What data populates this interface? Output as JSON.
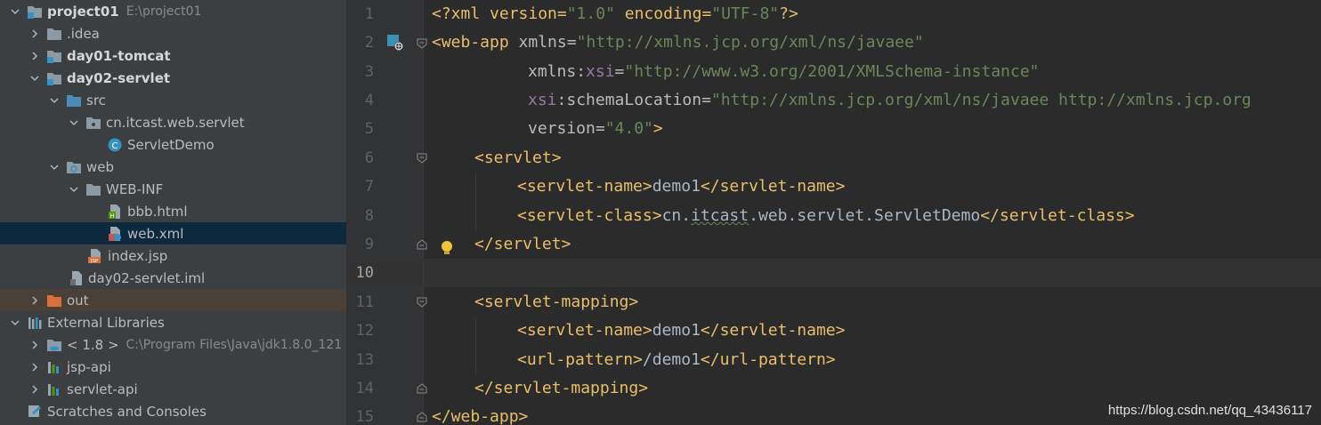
{
  "project_tree": {
    "project": {
      "name": "project01",
      "path": "E:\\project01"
    },
    "items": [
      {
        "label": ".idea"
      },
      {
        "label": "day01-tomcat"
      },
      {
        "label": "day02-servlet"
      },
      {
        "label": "src"
      },
      {
        "label": "cn.itcast.web.servlet"
      },
      {
        "label": "ServletDemo"
      },
      {
        "label": "web"
      },
      {
        "label": "WEB-INF"
      },
      {
        "label": "bbb.html"
      },
      {
        "label": "web.xml"
      },
      {
        "label": "index.jsp"
      },
      {
        "label": "day02-servlet.iml"
      },
      {
        "label": "out"
      },
      {
        "label": "External Libraries"
      },
      {
        "label": "< 1.8 >",
        "path": "C:\\Program Files\\Java\\jdk1.8.0_121"
      },
      {
        "label": "jsp-api"
      },
      {
        "label": "servlet-api"
      },
      {
        "label": "Scratches and Consoles"
      }
    ],
    "selected": "web.xml"
  },
  "editor": {
    "current_line": 10,
    "line_numbers": [
      "1",
      "2",
      "3",
      "4",
      "5",
      "6",
      "7",
      "8",
      "9",
      "10",
      "11",
      "12",
      "13",
      "14",
      "15"
    ],
    "lines": [
      [
        "<?xml version=",
        "\"1.0\"",
        " encoding=",
        "\"UTF-8\"",
        "?>"
      ],
      [
        "<web-app",
        " xmlns=",
        "\"http://xmlns.jcp.org/xml/ns/javaee\""
      ],
      [
        "xmlns",
        ":",
        "xsi",
        "=",
        "\"http://www.w3.org/2001/XMLSchema-instance\""
      ],
      [
        "xsi",
        ":schemaLocation=",
        "\"http://xmlns.jcp.org/xml/ns/javaee http://xmlns.jcp.org"
      ],
      [
        "version=",
        "\"4.0\"",
        ">"
      ],
      [
        "<servlet>"
      ],
      [
        "<servlet-name>",
        "demo1",
        "</servlet-name>"
      ],
      [
        "<servlet-class>",
        "cn.",
        "itcast",
        ".web.servlet.ServletDemo",
        "</servlet-class>"
      ],
      [
        "</servlet>"
      ],
      [],
      [
        "<servlet-mapping>"
      ],
      [
        "<servlet-name>",
        "demo1",
        "</servlet-name>"
      ],
      [
        "<url-pattern>",
        "/demo1",
        "</url-pattern>"
      ],
      [
        "</servlet-mapping>"
      ],
      [
        "</web-app>"
      ]
    ]
  },
  "watermark": "https://blog.csdn.net/qq_43436117",
  "colors": {
    "tree_bg": "#3c3f41",
    "selection": "#0d293e",
    "editor_bg": "#2b2b2b",
    "tag": "#e8bf6a",
    "string": "#6a8759",
    "namespace": "#9876aa",
    "text": "#a9b7c6"
  },
  "icons": [
    "folder-icon",
    "module-icon",
    "source-folder-icon",
    "package-icon",
    "class-icon",
    "web-folder-icon",
    "html-file-icon",
    "xml-file-icon",
    "jsp-file-icon",
    "iml-file-icon",
    "out-folder-icon",
    "libraries-icon",
    "jdk-icon",
    "library-icon",
    "scratches-icon",
    "bulb-icon",
    "web-xml-gutter-icon",
    "fold-icon"
  ]
}
